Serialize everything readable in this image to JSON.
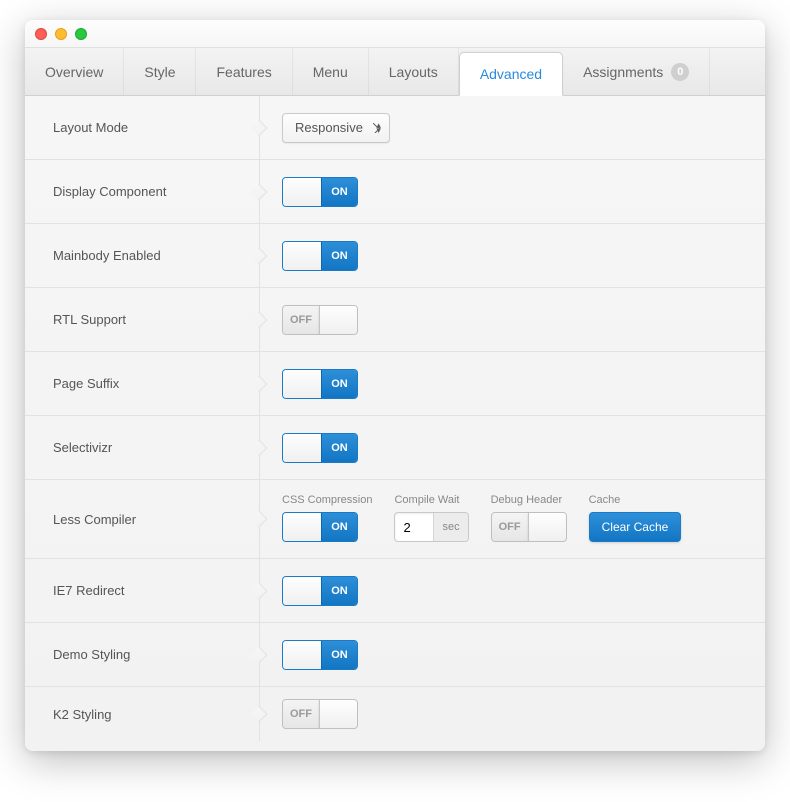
{
  "tabs": {
    "overview": "Overview",
    "style": "Style",
    "features": "Features",
    "menu": "Menu",
    "layouts": "Layouts",
    "advanced": "Advanced",
    "assignments": "Assignments",
    "assignments_count": "0"
  },
  "toggle": {
    "on": "ON",
    "off": "OFF"
  },
  "rows": {
    "layout_mode": {
      "label": "Layout Mode",
      "value": "Responsive"
    },
    "display_component": {
      "label": "Display Component",
      "state": "on"
    },
    "mainbody_enabled": {
      "label": "Mainbody Enabled",
      "state": "on"
    },
    "rtl_support": {
      "label": "RTL Support",
      "state": "off"
    },
    "page_suffix": {
      "label": "Page Suffix",
      "state": "on"
    },
    "selectivizr": {
      "label": "Selectivizr",
      "state": "on"
    },
    "less_compiler": {
      "label": "Less Compiler",
      "css_compression": {
        "label": "CSS Compression",
        "state": "on"
      },
      "compile_wait": {
        "label": "Compile Wait",
        "value": "2",
        "suffix": "sec"
      },
      "debug_header": {
        "label": "Debug Header",
        "state": "off"
      },
      "cache": {
        "label": "Cache",
        "button": "Clear Cache"
      }
    },
    "ie7_redirect": {
      "label": "IE7 Redirect",
      "state": "on"
    },
    "demo_styling": {
      "label": "Demo Styling",
      "state": "on"
    },
    "k2_styling": {
      "label": "K2 Styling",
      "state": "off"
    }
  }
}
